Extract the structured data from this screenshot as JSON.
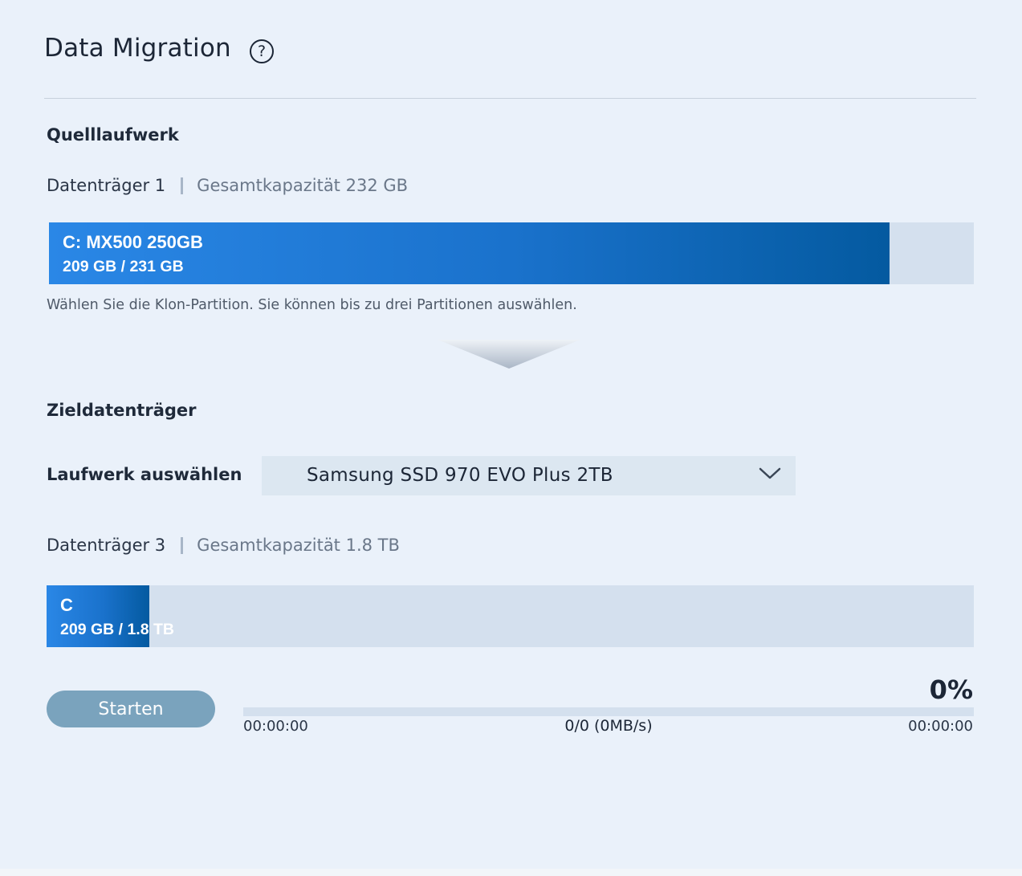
{
  "header": {
    "title": "Data Migration",
    "help_glyph": "?"
  },
  "source": {
    "section_title": "Quelllaufwerk",
    "disk_name": "Datenträger 1",
    "capacity_label": "Gesamtkapazität 232 GB",
    "partition": {
      "name": "C: MX500 250GB",
      "usage": "209 GB / 231 GB",
      "fill_fraction": 0.909
    },
    "hint": "Wählen Sie die Klon-Partition. Sie können bis zu drei Partitionen auswählen."
  },
  "target": {
    "section_title": "Zieldatenträger",
    "select_label": "Laufwerk auswählen",
    "selected_drive": "Samsung SSD 970 EVO Plus 2TB",
    "disk_name": "Datenträger 3",
    "capacity_label": "Gesamtkapazität 1.8 TB",
    "partition": {
      "name": "C",
      "usage": "209 GB / 1.8 TB",
      "fill_fraction": 0.111
    }
  },
  "progress": {
    "start_label": "Starten",
    "percent_text": "0%",
    "percent_value": 0,
    "elapsed": "00:00:00",
    "rate": "0/0 (0MB/s)",
    "remaining": "00:00:00"
  },
  "colors": {
    "background": "#eaf1fa",
    "accent_start": "#2a87e6",
    "accent_end": "#045aa0",
    "track": "#d4e0ee",
    "button": "#7aa3bd"
  },
  "icons": {
    "help": "help-circle-icon",
    "dropdown": "chevron-down-icon",
    "flow": "arrow-down-icon"
  }
}
